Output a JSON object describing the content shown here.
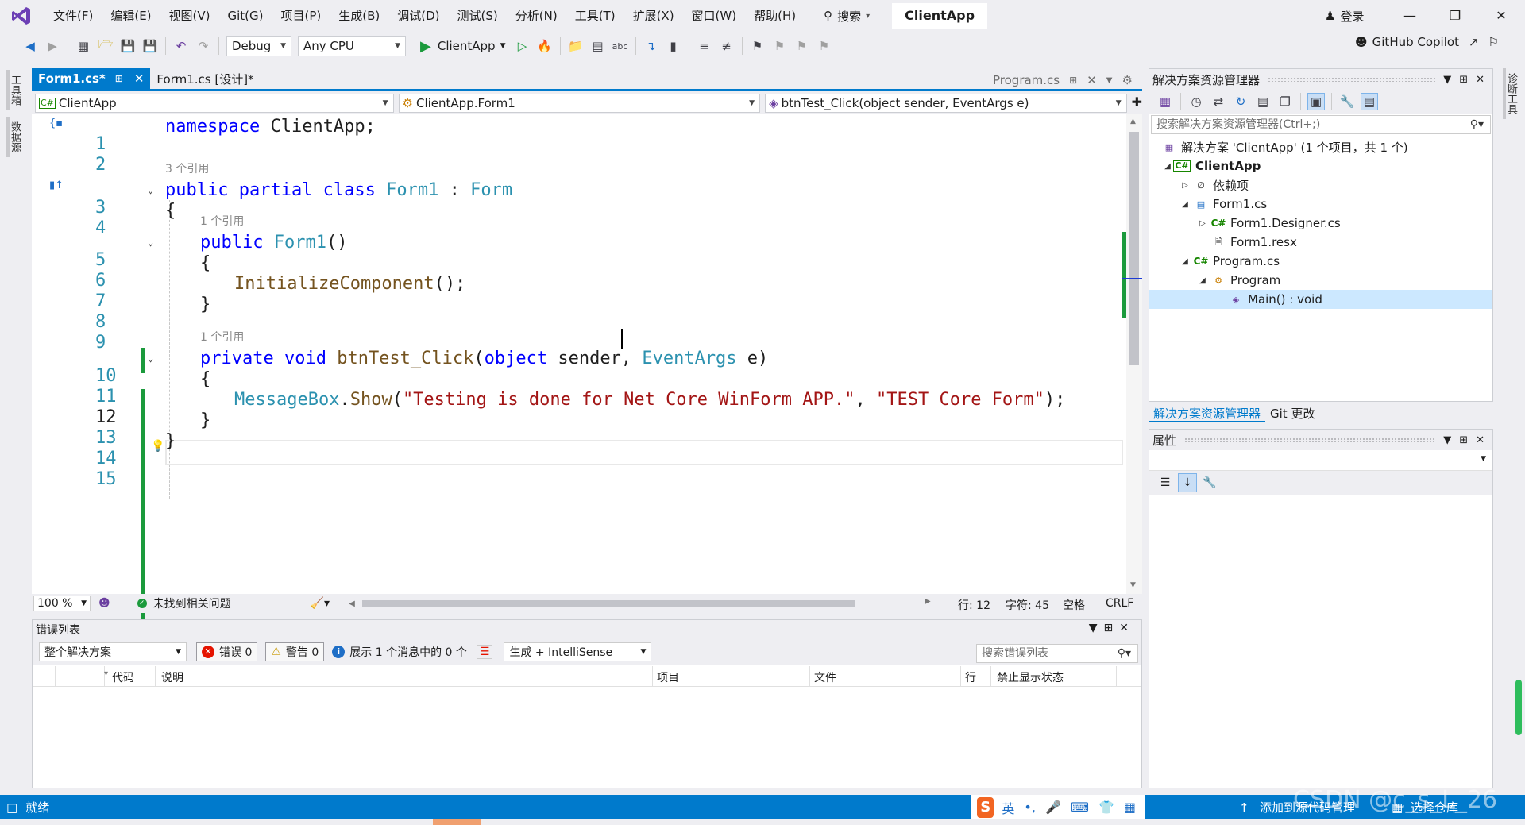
{
  "menubar": {
    "items": [
      "文件(F)",
      "编辑(E)",
      "视图(V)",
      "Git(G)",
      "项目(P)",
      "生成(B)",
      "调试(D)",
      "测试(S)",
      "分析(N)",
      "工具(T)",
      "扩展(X)",
      "窗口(W)",
      "帮助(H)"
    ],
    "search_label": "搜索",
    "solution_title": "ClientApp",
    "login_label": "登录"
  },
  "toolbar": {
    "config": "Debug",
    "platform": "Any CPU",
    "run_target": "ClientApp",
    "copilot_label": "GitHub Copilot"
  },
  "left_rail": {
    "tabs": [
      "工具箱",
      "数据源"
    ]
  },
  "right_rail": {
    "tabs": [
      "诊断工具"
    ]
  },
  "editor_tabs": [
    {
      "label": "Form1.cs*",
      "active": true
    },
    {
      "label": "Form1.cs [设计]*",
      "active": false
    }
  ],
  "preview_tab": {
    "label": "Program.cs"
  },
  "navbar": {
    "project": "ClientApp",
    "type": "ClientApp.Form1",
    "member": "btnTest_Click(object sender, EventArgs e)"
  },
  "code": {
    "line_numbers": [
      "1",
      "2",
      "3",
      "4",
      "5",
      "6",
      "7",
      "8",
      "9",
      "10",
      "11",
      "12",
      "13",
      "14",
      "15"
    ],
    "ref_hints": [
      "3 个引用",
      "1 个引用",
      "1 个引用"
    ],
    "line1": {
      "kw": "namespace",
      "rest": " ClientApp;"
    },
    "line3": {
      "kw": "public partial class",
      "type": "Form1",
      "sep": " : ",
      "base": "Form"
    },
    "line4": "{",
    "line5": {
      "kw": "public",
      "type": "Form1",
      "rest": "()"
    },
    "line6": "{",
    "line7": {
      "fn": "InitializeComponent",
      "rest": "();"
    },
    "line8": "}",
    "line10": {
      "kw": "private void",
      "fn": "btnTest_Click",
      "open": "(",
      "kw2": "object",
      "mid": " sender, ",
      "type": "EventArgs",
      "rest": " e)"
    },
    "line11": "{",
    "line12": {
      "type": "MessageBox",
      "dot": ".",
      "fn": "Show",
      "open": "(",
      "str1": "\"Testing is done for Net Core WinForm APP.\"",
      "comma": ", ",
      "str2": "\"TEST Core Form\"",
      "rest": ");"
    },
    "line13": "}",
    "line14": "}"
  },
  "editor_status": {
    "zoom": "100 %",
    "issues": "未找到相关问题",
    "line": "行: 12",
    "char": "字符: 45",
    "whitespace": "空格",
    "eol": "CRLF"
  },
  "error_list": {
    "title": "错误列表",
    "scope": "整个解决方案",
    "errors": "错误 0",
    "warnings": "警告 0",
    "messages": "展示 1 个消息中的 0 个",
    "build_filter": "生成 + IntelliSense",
    "search_placeholder": "搜索错误列表",
    "columns": [
      "代码",
      "说明",
      "项目",
      "文件",
      "行",
      "禁止显示状态"
    ]
  },
  "solution_explorer": {
    "title": "解决方案资源管理器",
    "search_placeholder": "搜索解决方案资源管理器(Ctrl+;)",
    "tree": [
      {
        "label": "解决方案 'ClientApp' (1 个项目，共 1 个)",
        "icon": "solution-icon"
      },
      {
        "label": "ClientApp",
        "icon": "csproj-icon"
      },
      {
        "label": "依赖项",
        "icon": "dependencies-icon"
      },
      {
        "label": "Form1.cs",
        "icon": "form-icon"
      },
      {
        "label": "Form1.Designer.cs",
        "icon": "csharp-file-icon"
      },
      {
        "label": "Form1.resx",
        "icon": "resx-file-icon"
      },
      {
        "label": "Program.cs",
        "icon": "csharp-file-icon"
      },
      {
        "label": "Program",
        "icon": "class-icon"
      },
      {
        "label": "Main() : void",
        "icon": "method-icon"
      }
    ],
    "bottom_tabs": [
      "解决方案资源管理器",
      "Git 更改"
    ]
  },
  "properties": {
    "title": "属性"
  },
  "statusbar": {
    "ready": "就绪",
    "add_source": "添加到源代码管理",
    "select_repo": "选择仓库"
  },
  "ime": {
    "lang": "英"
  },
  "watermark": "CSDN @c_s_L_26",
  "colors": {
    "accent": "#007acc",
    "keyword": "#0000ff",
    "type": "#2b91af",
    "string": "#a31515",
    "method": "#74531f",
    "change_bar": "#1b9a3c"
  }
}
